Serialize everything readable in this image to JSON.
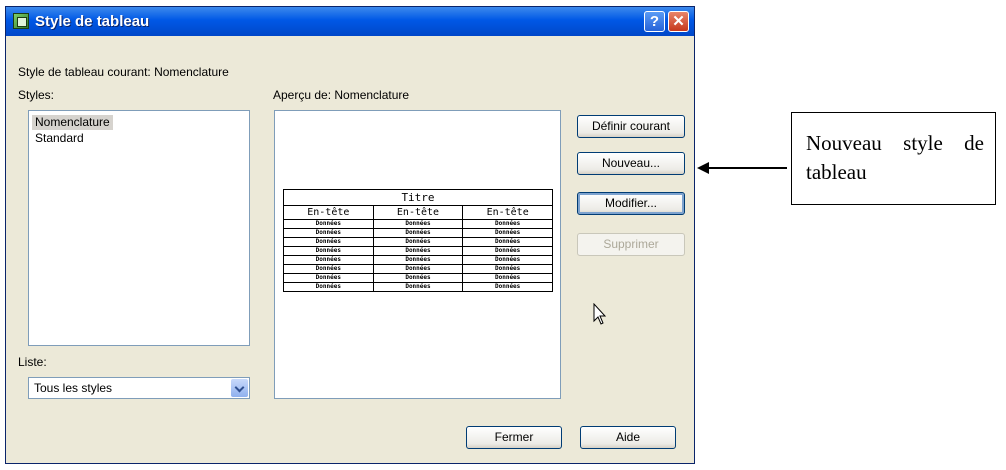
{
  "window": {
    "title": "Style de tableau",
    "help_glyph": "?",
    "close_glyph": "✕"
  },
  "current_style_label": "Style de tableau courant: Nomenclature",
  "styles": {
    "label": "Styles:",
    "items": [
      "Nomenclature",
      "Standard"
    ],
    "selected": "Nomenclature"
  },
  "preview": {
    "label": "Aperçu de: Nomenclature",
    "table": {
      "title": "Titre",
      "headers": [
        "En-tête",
        "En-tête",
        "En-tête"
      ],
      "rows": [
        [
          "Données",
          "Données",
          "Données"
        ],
        [
          "Données",
          "Données",
          "Données"
        ],
        [
          "Données",
          "Données",
          "Données"
        ],
        [
          "Données",
          "Données",
          "Données"
        ],
        [
          "Données",
          "Données",
          "Données"
        ],
        [
          "Données",
          "Données",
          "Données"
        ],
        [
          "Données",
          "Données",
          "Données"
        ],
        [
          "Données",
          "Données",
          "Données"
        ]
      ]
    }
  },
  "list_filter": {
    "label": "Liste:",
    "value": "Tous les styles"
  },
  "buttons": {
    "set_current": "Définir courant",
    "new": "Nouveau...",
    "modify": "Modifier...",
    "delete": "Supprimer",
    "close": "Fermer",
    "help": "Aide"
  },
  "annotation": {
    "text": "Nouveau style de tableau"
  },
  "icons": {
    "app": "table-style-app-icon",
    "cursor": "mouse-pointer-icon",
    "dropdown": "chevron-down-icon"
  },
  "colors": {
    "titlebar": "#0058e6",
    "dialog_bg": "#ece9d8",
    "close_button": "#c5381c"
  }
}
